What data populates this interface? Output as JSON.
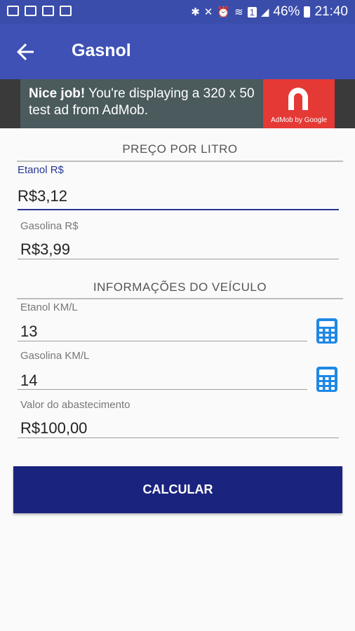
{
  "status_bar": {
    "battery": "46%",
    "time": "21:40",
    "sim": "1"
  },
  "app_bar": {
    "title": "Gasnol"
  },
  "ad": {
    "headline": "Nice job!",
    "body": " You're displaying a 320 x 50 test ad from AdMob.",
    "logo_caption": "AdMob by Google"
  },
  "section_price": {
    "title": "PREÇO POR LITRO",
    "ethanol_label": "Etanol R$",
    "ethanol_value": "R$3,12",
    "gasoline_label": "Gasolina R$",
    "gasoline_value": "R$3,99"
  },
  "section_vehicle": {
    "title": "INFORMAÇÕES DO VEÍCULO",
    "ethanol_kml_label": "Etanol KM/L",
    "ethanol_kml_value": "13",
    "gasoline_kml_label": "Gasolina KM/L",
    "gasoline_kml_value": "14",
    "fuel_amount_label": "Valor do abastecimento",
    "fuel_amount_value": "R$100,00"
  },
  "calculate_button": "CALCULAR",
  "colors": {
    "primary": "#3f51b5",
    "primary_dark": "#1a237e",
    "accent_icon": "#1e88e5",
    "ad_logo": "#e53935"
  }
}
